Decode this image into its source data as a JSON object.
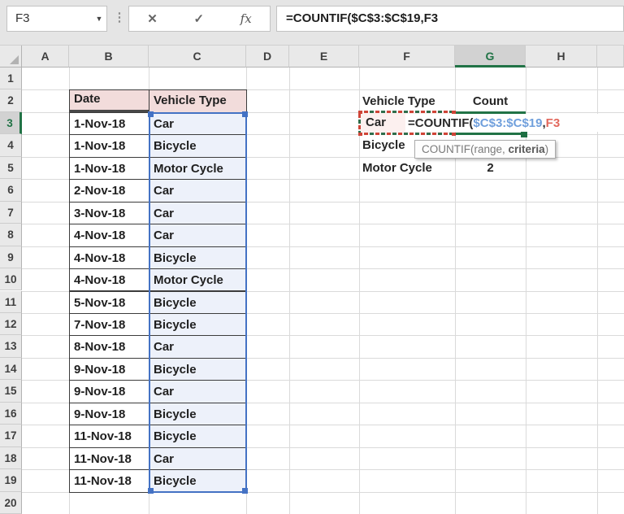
{
  "formula_bar": {
    "name_box": "F3",
    "formula": "=COUNTIF($C$3:$C$19,F3",
    "icons": {
      "dropdown": "▼",
      "separator": "⋮",
      "cancel": "✕",
      "enter": "✓",
      "function": "fx"
    }
  },
  "sheet": {
    "column_letters": [
      "A",
      "B",
      "C",
      "D",
      "E",
      "F",
      "G",
      "H"
    ],
    "row_numbers": [
      "1",
      "2",
      "3",
      "4",
      "5",
      "6",
      "7",
      "8",
      "9",
      "10",
      "11",
      "12",
      "13",
      "14",
      "15",
      "16",
      "17",
      "18",
      "19",
      "20"
    ],
    "selected_column": "G",
    "selected_row": "3"
  },
  "left_table": {
    "headers": [
      "Date",
      "Vehicle Type"
    ],
    "rows": [
      [
        "1-Nov-18",
        "Car"
      ],
      [
        "1-Nov-18",
        "Bicycle"
      ],
      [
        "1-Nov-18",
        "Motor Cycle"
      ],
      [
        "2-Nov-18",
        "Car"
      ],
      [
        "3-Nov-18",
        "Car"
      ],
      [
        "4-Nov-18",
        "Car"
      ],
      [
        "4-Nov-18",
        "Bicycle"
      ],
      [
        "4-Nov-18",
        "Motor Cycle"
      ],
      [
        "5-Nov-18",
        "Bicycle"
      ],
      [
        "7-Nov-18",
        "Bicycle"
      ],
      [
        "8-Nov-18",
        "Car"
      ],
      [
        "9-Nov-18",
        "Bicycle"
      ],
      [
        "9-Nov-18",
        "Car"
      ],
      [
        "9-Nov-18",
        "Bicycle"
      ],
      [
        "11-Nov-18",
        "Bicycle"
      ],
      [
        "11-Nov-18",
        "Car"
      ],
      [
        "11-Nov-18",
        "Bicycle"
      ]
    ]
  },
  "right_table": {
    "headers": [
      "Vehicle Type",
      "Count"
    ],
    "rows": [
      {
        "vehicle": "Car",
        "count": ""
      },
      {
        "vehicle": "Bicycle",
        "count": ""
      },
      {
        "vehicle": "Motor Cycle",
        "count": "2"
      }
    ]
  },
  "in_cell_formula": {
    "prefix": "=COUNTIF(",
    "range": "$C$3:$C$19",
    "separator": ",",
    "criteria": "F3"
  },
  "tooltip": {
    "prefix": "COUNTIF(",
    "arg_range": "range",
    "separator": ", ",
    "arg_criteria": "criteria",
    "suffix": ")"
  },
  "colors": {
    "accent_green": "#217346",
    "reference_blue": "#4472c4",
    "reference_red": "#cf4437",
    "header_pink_fill": "#f2dcdb",
    "range_blue_fill": "#edf1fa",
    "criteria_pink_fill": "#fcf0ef"
  }
}
